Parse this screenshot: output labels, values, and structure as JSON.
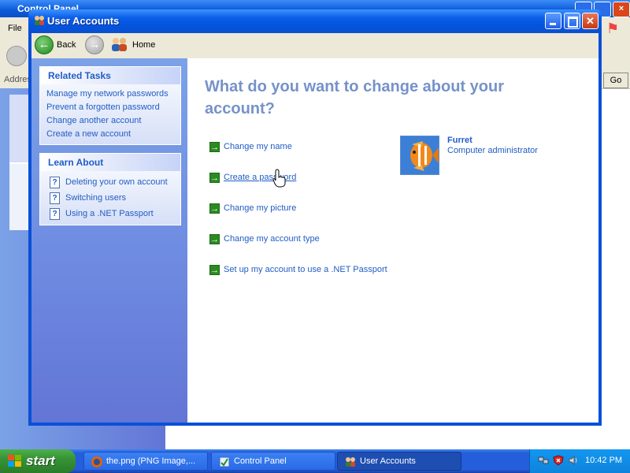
{
  "background_window": {
    "title": "Control Panel",
    "menu_file": "File",
    "address_label": "Addres",
    "go_label": "Go"
  },
  "window": {
    "title": "User Accounts"
  },
  "toolbar": {
    "back_label": "Back",
    "home_label": "Home"
  },
  "sidebar": {
    "related_tasks": {
      "header": "Related Tasks",
      "links": [
        "Manage my network passwords",
        "Prevent a forgotten password",
        "Change another account",
        "Create a new account"
      ]
    },
    "learn_about": {
      "header": "Learn About",
      "links": [
        "Deleting your own account",
        "Switching users",
        "Using a .NET Passport"
      ]
    }
  },
  "main": {
    "title": "What do you want to change about your account?",
    "tasks": [
      "Change my name",
      "Create a password",
      "Change my picture",
      "Change my account type",
      "Set up my account to use a .NET Passport"
    ]
  },
  "account": {
    "name": "Furret",
    "type": "Computer administrator"
  },
  "taskbar": {
    "start_label": "start",
    "buttons": [
      "the.png (PNG Image,...",
      "Control Panel",
      "User Accounts"
    ],
    "clock": "10:42 PM"
  },
  "colors": {
    "link": "#215dc6",
    "title_blue": "#7592c9",
    "task_arrow_green": "#2b8b21",
    "titlebar_blue": "#0354dc"
  }
}
